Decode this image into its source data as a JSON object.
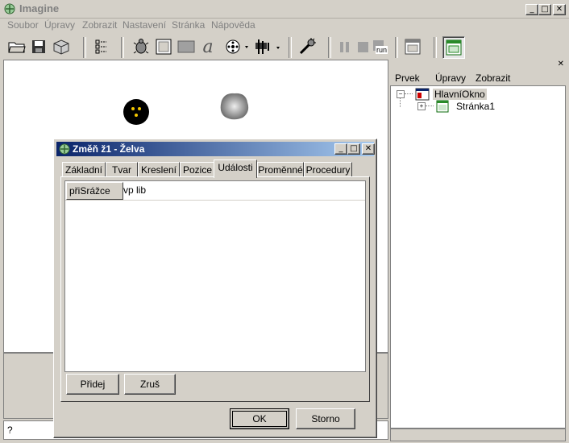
{
  "app": {
    "title": "Imagine"
  },
  "menu": [
    "Soubor",
    "Úpravy",
    "Zobrazit",
    "Nastavení",
    "Stránka",
    "Nápověda"
  ],
  "toolbar": {
    "stop_label": "run"
  },
  "right_panel": {
    "menu": [
      "Prvek",
      "Úpravy",
      "Zobrazit"
    ],
    "tree": [
      {
        "label": "HlavníOkno",
        "expanded": true
      },
      {
        "label": "Stránka1",
        "expanded": false
      }
    ]
  },
  "command_line": {
    "value": "?"
  },
  "dialog": {
    "title": "Změň ž1  - Želva",
    "tabs": [
      "Základní",
      "Tvar",
      "Kreslení",
      "Pozice",
      "Události",
      "Proměnné",
      "Procedury"
    ],
    "active_tab": "Události",
    "events": [
      {
        "name": "přiSrážce",
        "value": "vp lib"
      }
    ],
    "buttons": {
      "add": "Přidej",
      "remove": "Zruš",
      "ok": "OK",
      "cancel": "Storno"
    }
  },
  "colors": {
    "titlebar_active": "#0a246a",
    "titlebar_gradient_end": "#a6caf0",
    "face": "#d4d0c8"
  }
}
